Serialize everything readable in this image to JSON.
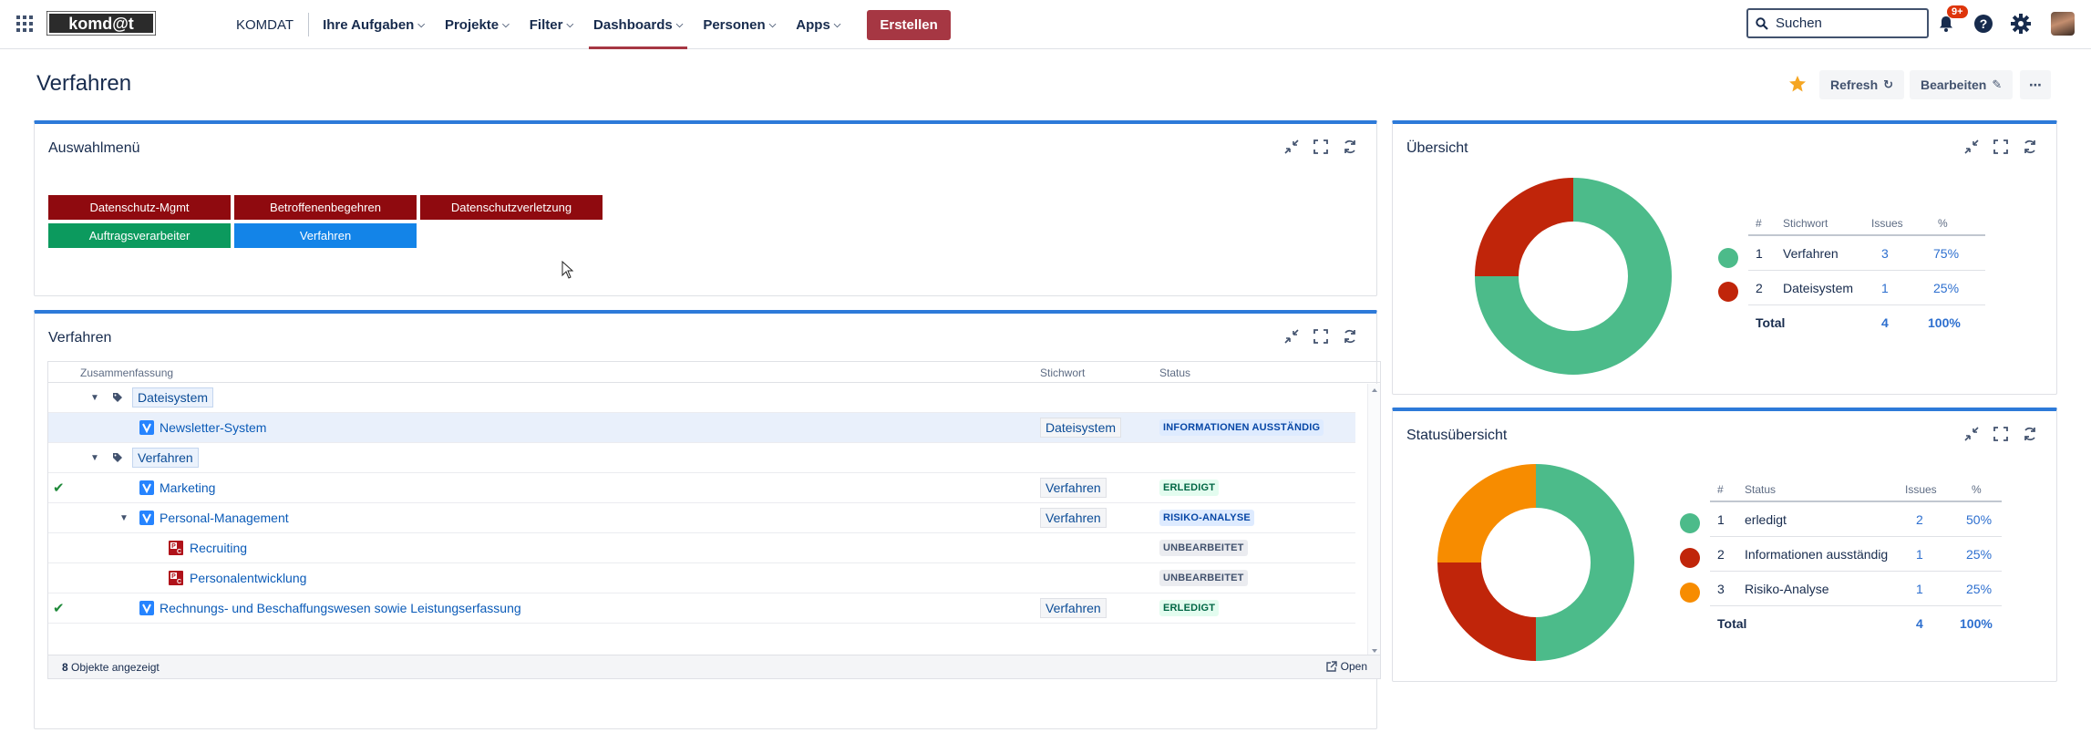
{
  "nav": {
    "logo_text": "komd@t",
    "items": [
      {
        "label": "KOMDAT",
        "has_chevron": false,
        "active": false
      },
      {
        "label": "Ihre Aufgaben",
        "has_chevron": true,
        "active": false
      },
      {
        "label": "Projekte",
        "has_chevron": true,
        "active": false
      },
      {
        "label": "Filter",
        "has_chevron": true,
        "active": false
      },
      {
        "label": "Dashboards",
        "has_chevron": true,
        "active": true
      },
      {
        "label": "Personen",
        "has_chevron": true,
        "active": false
      },
      {
        "label": "Apps",
        "has_chevron": true,
        "active": false
      }
    ],
    "create_label": "Erstellen",
    "search_placeholder": "Suchen",
    "notification_count": "9+"
  },
  "page": {
    "title": "Verfahren",
    "refresh_label": "Refresh",
    "edit_label": "Bearbeiten"
  },
  "auswahl": {
    "title": "Auswahlmenü",
    "buttons": [
      {
        "label": "Datenschutz-Mgmt",
        "color": "#8f0a0f"
      },
      {
        "label": "Betroffenenbegehren",
        "color": "#8f0a0f"
      },
      {
        "label": "Datenschutzverletzung",
        "color": "#8f0a0f"
      },
      {
        "label": "Auftragsverarbeiter",
        "color": "#0c9a5e"
      },
      {
        "label": "Verfahren",
        "color": "#1384e8"
      }
    ]
  },
  "verfahren": {
    "title": "Verfahren",
    "columns": {
      "summary": "Zusammenfassung",
      "keyword": "Stichwort",
      "status": "Status"
    },
    "rows": [
      {
        "type": "group",
        "label": "Dateisystem"
      },
      {
        "type": "issue",
        "summary": "Newsletter-System",
        "keyword": "Dateisystem",
        "status": "INFORMATIONEN AUSSTÄNDIG",
        "status_color": "blue",
        "done": false
      },
      {
        "type": "group",
        "label": "Verfahren"
      },
      {
        "type": "issue",
        "summary": "Marketing",
        "keyword": "Verfahren",
        "status": "ERLEDIGT",
        "status_color": "green",
        "done": true
      },
      {
        "type": "issue",
        "summary": "Personal-Management",
        "keyword": "Verfahren",
        "status": "RISIKO-ANALYSE",
        "status_color": "blue",
        "done": false
      },
      {
        "type": "subtask",
        "summary": "Recruiting",
        "keyword": "",
        "status": "UNBEARBEITET",
        "status_color": "grey",
        "done": false
      },
      {
        "type": "subtask",
        "summary": "Personalentwicklung",
        "keyword": "",
        "status": "UNBEARBEITET",
        "status_color": "grey",
        "done": false
      },
      {
        "type": "issue",
        "summary": "Rechnungs- und Beschaffungswesen sowie Leistungserfassung",
        "keyword": "Verfahren",
        "status": "ERLEDIGT",
        "status_color": "green",
        "done": true
      }
    ],
    "footer_count": "8",
    "footer_text": "Objekte angezeigt",
    "open_label": "Open"
  },
  "uebersicht": {
    "title": "Übersicht",
    "headers": {
      "num": "#",
      "name": "Stichwort",
      "issues": "Issues",
      "pct": "%"
    },
    "rows": [
      {
        "num": "1",
        "name": "Verfahren",
        "issues": "3",
        "pct": "75%",
        "color": "#4cbb8a"
      },
      {
        "num": "2",
        "name": "Dateisystem",
        "issues": "1",
        "pct": "25%",
        "color": "#c0250a"
      }
    ],
    "total_label": "Total",
    "total_issues": "4",
    "total_pct": "100%"
  },
  "statusuebersicht": {
    "title": "Statusübersicht",
    "headers": {
      "num": "#",
      "name": "Status",
      "issues": "Issues",
      "pct": "%"
    },
    "rows": [
      {
        "num": "1",
        "name": "erledigt",
        "issues": "2",
        "pct": "50%",
        "color": "#4cbb8a"
      },
      {
        "num": "2",
        "name": "Informationen ausständig",
        "issues": "1",
        "pct": "25%",
        "color": "#c0250a"
      },
      {
        "num": "3",
        "name": "Risiko-Analyse",
        "issues": "1",
        "pct": "25%",
        "color": "#f78c00"
      }
    ],
    "total_label": "Total",
    "total_issues": "4",
    "total_pct": "100%"
  },
  "chart_data": [
    {
      "type": "pie",
      "categories": [
        "Verfahren",
        "Dateisystem"
      ],
      "values": [
        3,
        1
      ],
      "colors": [
        "#4cbb8a",
        "#c0250a"
      ]
    },
    {
      "type": "pie",
      "categories": [
        "erledigt",
        "Informationen ausständig",
        "Risiko-Analyse"
      ],
      "values": [
        2,
        1,
        1
      ],
      "colors": [
        "#4cbb8a",
        "#c0250a",
        "#f78c00"
      ]
    }
  ]
}
